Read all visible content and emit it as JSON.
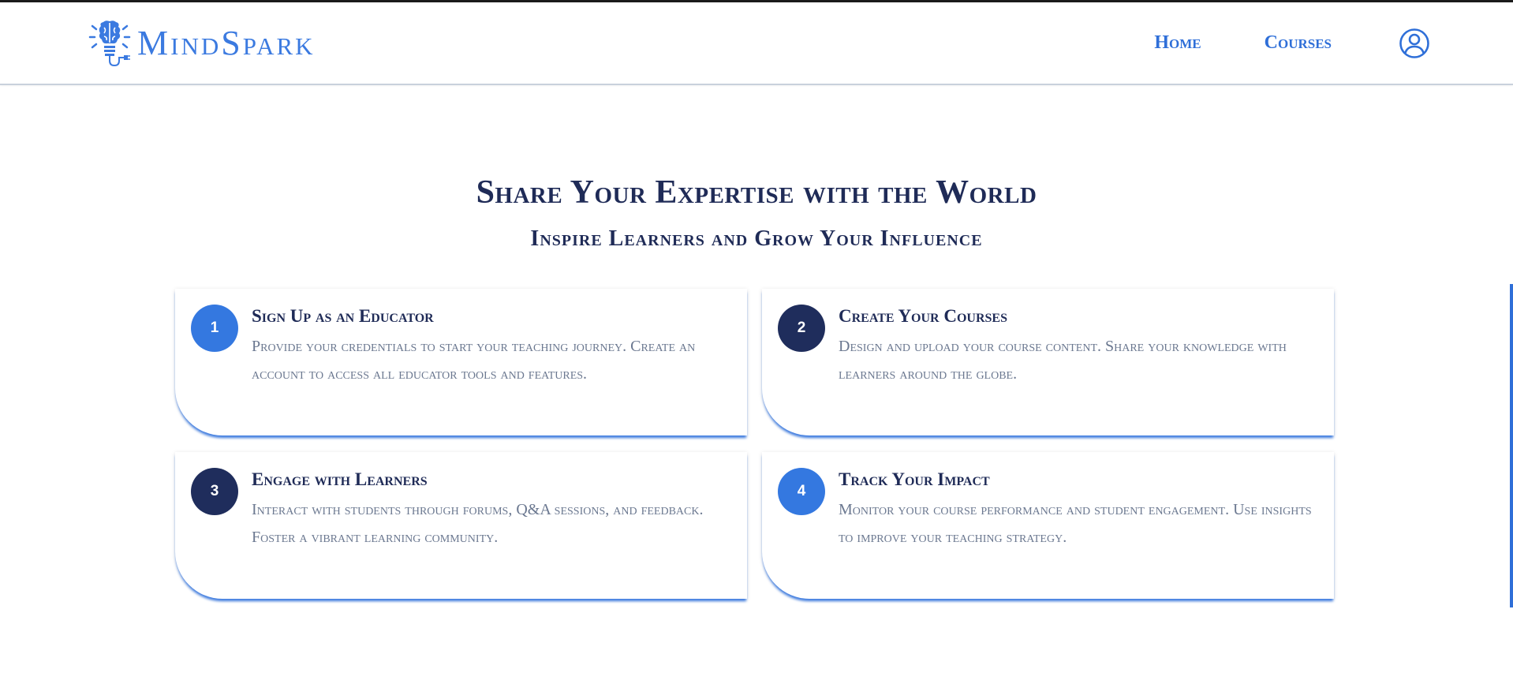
{
  "brand": {
    "name": "MindSpark",
    "accent_color": "#3b7ae0"
  },
  "nav": {
    "home": "Home",
    "courses": "Courses",
    "profile_icon": "user-circle-icon"
  },
  "hero": {
    "title": "Share Your Expertise with the World",
    "subtitle": "Inspire Learners and Grow Your Influence"
  },
  "steps": [
    {
      "number": "1",
      "title": "Sign Up as an Educator",
      "description": "Provide your credentials to start your teaching journey. Create an account to access all educator tools and features.",
      "badge_color": "#3478e0"
    },
    {
      "number": "2",
      "title": "Create Your Courses",
      "description": "Design and upload your course content. Share your knowledge with learners around the globe.",
      "badge_color": "#1f2d5c"
    },
    {
      "number": "3",
      "title": "Engage with Learners",
      "description": "Interact with students through forums, Q&A sessions, and feedback. Foster a vibrant learning community.",
      "badge_color": "#1f2d5c"
    },
    {
      "number": "4",
      "title": "Track Your Impact",
      "description": "Monitor your course performance and student engagement. Use insights to improve your teaching strategy.",
      "badge_color": "#3478e0"
    }
  ]
}
